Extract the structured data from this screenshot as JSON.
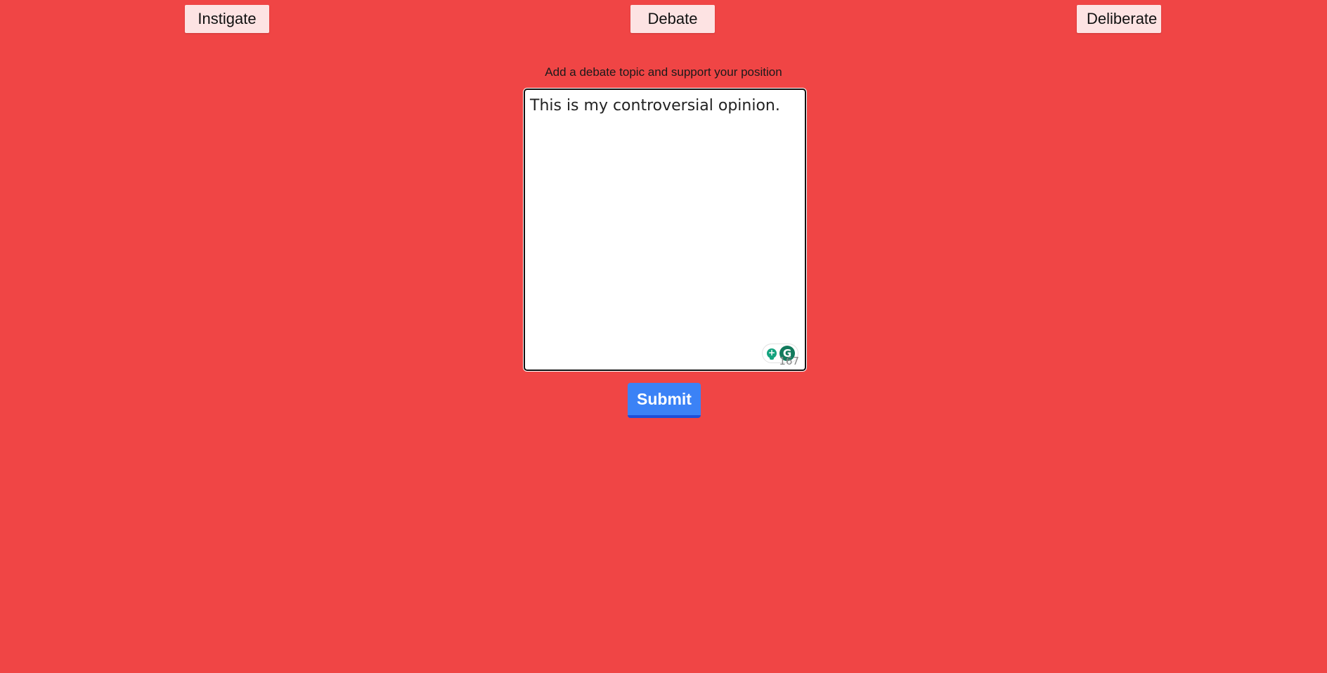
{
  "nav": {
    "instigate_label": "Instigate",
    "debate_label": "Debate",
    "deliberate_label": "Deliberate"
  },
  "form": {
    "prompt": "Add a debate topic and support your position",
    "text_value": "This is my controversial opinion.",
    "char_count": "167",
    "grammarly_letter": "G",
    "submit_label": "Submit"
  },
  "colors": {
    "background": "#f04545",
    "nav_button": "#fde3e3",
    "submit_button": "#3b82f6",
    "grammarly": "#15a37f"
  }
}
